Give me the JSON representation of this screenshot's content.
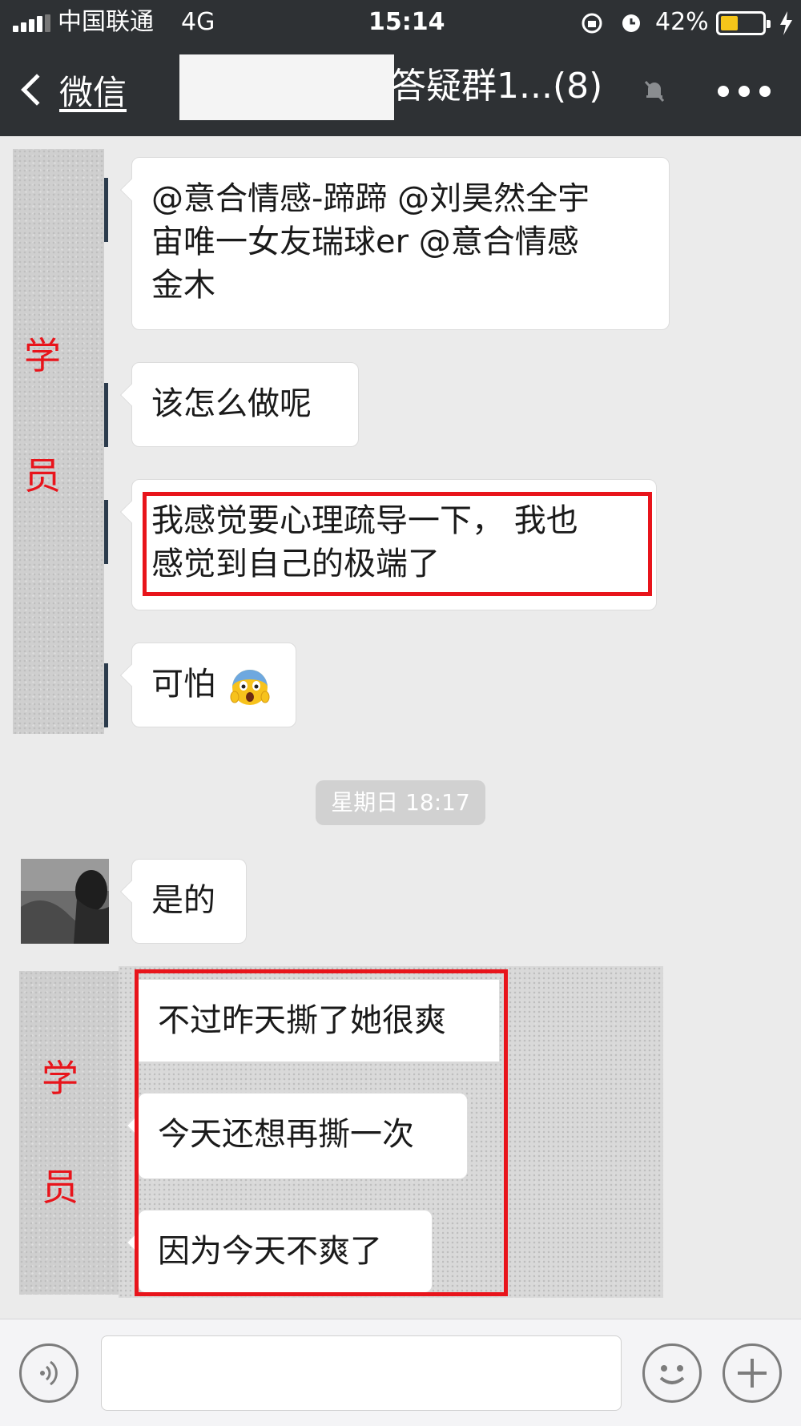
{
  "status_bar": {
    "carrier": "中国联通",
    "network": "4G",
    "time": "15:14",
    "battery_percent": "42%",
    "battery_level": 0.42
  },
  "nav": {
    "back_label": "微信",
    "title": "答疑群1...(8)"
  },
  "messages": [
    {
      "text_lines": [
        "@意合情感-蹄蹄 @刘昊然全宇",
        "宙唯一女友瑞球er @意合情感",
        "金木"
      ]
    },
    {
      "text": "该怎么做呢"
    },
    {
      "text_lines": [
        "我感觉要心理疏导一下， 我也",
        "感觉到自己的极端了"
      ]
    },
    {
      "text": "可怕",
      "emoji": "screaming-face-emoji"
    },
    {
      "text": "是的"
    },
    {
      "text": "不过昨天撕了她很爽"
    },
    {
      "text": "今天还想再撕一次"
    },
    {
      "text": "因为今天不爽了"
    }
  ],
  "timestamp": "星期日 18:17",
  "annotations": {
    "student_1": "学",
    "student_2": "员"
  },
  "colors": {
    "nav_bg": "#2e3134",
    "chat_bg": "#ebebeb",
    "annotation_red": "#e8141b",
    "battery_yellow": "#f5c51a"
  }
}
